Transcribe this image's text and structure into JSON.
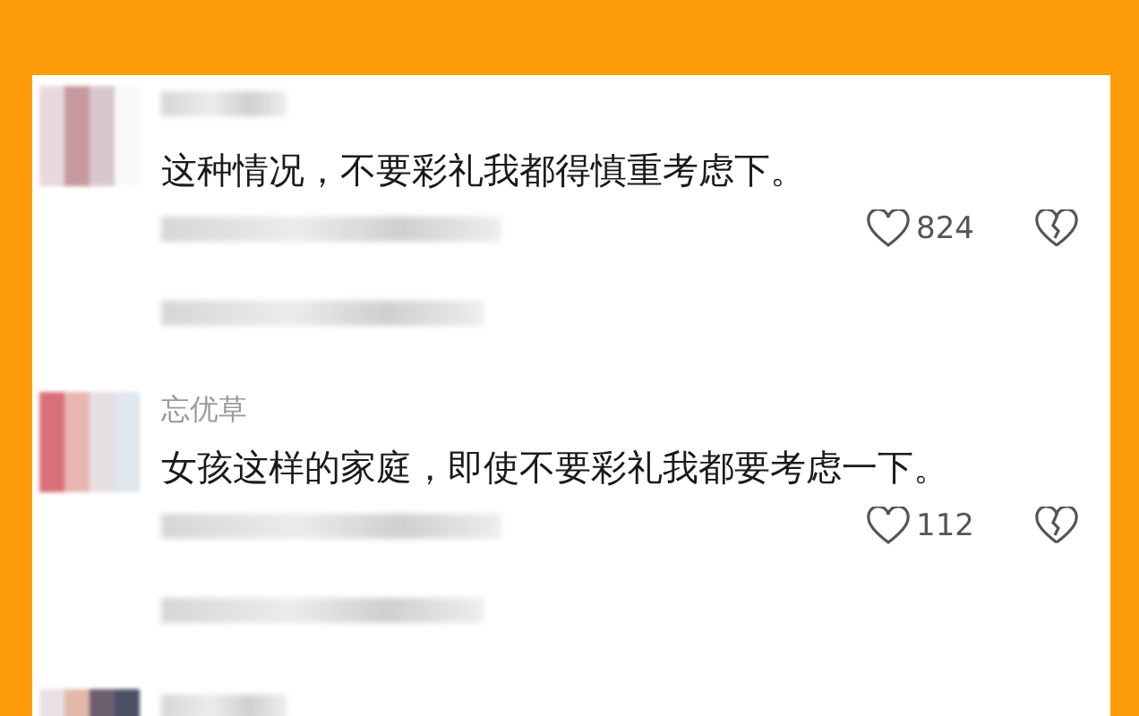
{
  "comments": [
    {
      "author_hidden": true,
      "text": "这种情况，不要彩礼我都得慎重考虑下。",
      "likes": "824"
    },
    {
      "author_hidden": false,
      "author": "忘优草",
      "text": "女孩这样的家庭，即使不要彩礼我都要考虑一下。",
      "likes": "112"
    },
    {
      "author_hidden": true
    }
  ]
}
